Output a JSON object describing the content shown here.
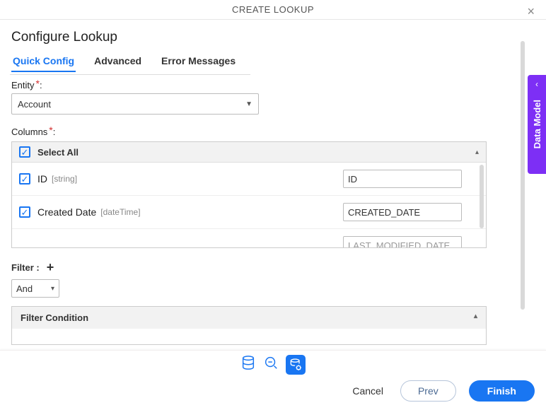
{
  "titlebar": {
    "title": "CREATE LOOKUP"
  },
  "page": {
    "heading": "Configure Lookup"
  },
  "tabs": {
    "quick": "Quick Config",
    "advanced": "Advanced",
    "errors": "Error Messages"
  },
  "entity": {
    "label": "Entity",
    "value": "Account"
  },
  "columns": {
    "label": "Columns",
    "selectAll": "Select All",
    "items": [
      {
        "name": "ID",
        "type": "string",
        "alias": "ID"
      },
      {
        "name": "Created Date",
        "type": "dateTime",
        "alias": "CREATED_DATE"
      },
      {
        "name": "",
        "type": "",
        "alias": "LAST_MODIFIED_DATE"
      }
    ]
  },
  "filter": {
    "label": "Filter :",
    "op": "And",
    "panelTitle": "Filter Condition"
  },
  "side": {
    "label": "Data Model"
  },
  "footer": {
    "cancel": "Cancel",
    "prev": "Prev",
    "finish": "Finish"
  }
}
